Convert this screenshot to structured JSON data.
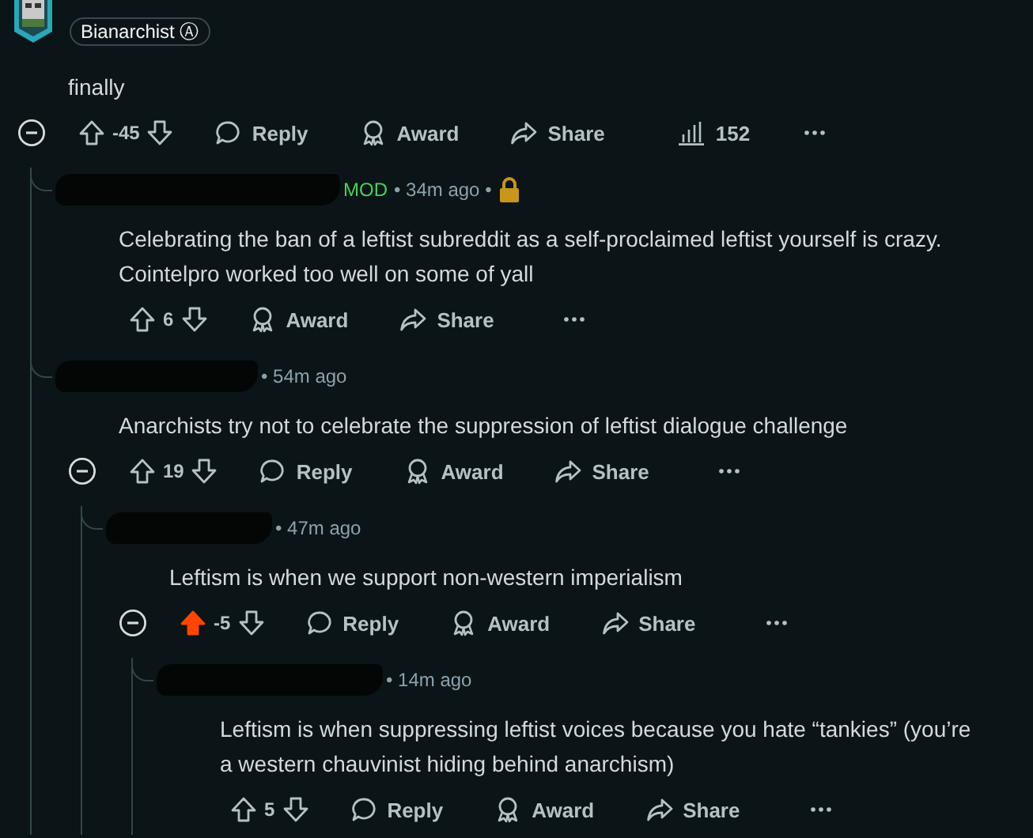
{
  "comments": [
    {
      "flair": "Bianarchist Ⓐ",
      "text": "finally",
      "score": "-45",
      "upvoted": false,
      "expanded": true,
      "views": "152",
      "actions": [
        {
          "kind": "reply",
          "label": "Reply"
        },
        {
          "kind": "award",
          "label": "Award"
        },
        {
          "kind": "share",
          "label": "Share"
        }
      ],
      "children": [
        {
          "role": "MOD",
          "time": "• 34m ago •",
          "locked": true,
          "text": "Celebrating the ban of a leftist subreddit as a self-proclaimed leftist yourself is crazy. Cointelpro worked too well on some of yall",
          "score": "6",
          "upvoted": false,
          "actions": [
            {
              "kind": "award",
              "label": "Award"
            },
            {
              "kind": "share",
              "label": "Share"
            }
          ]
        },
        {
          "time": "• 54m ago",
          "text": "Anarchists try not to celebrate the suppression of leftist dialogue challenge",
          "score": "19",
          "upvoted": false,
          "expanded": true,
          "actions": [
            {
              "kind": "reply",
              "label": "Reply"
            },
            {
              "kind": "award",
              "label": "Award"
            },
            {
              "kind": "share",
              "label": "Share"
            }
          ],
          "children": [
            {
              "time": "• 47m ago",
              "text": "Leftism is when we support non-western imperialism",
              "score": "-5",
              "upvoted": true,
              "expanded": true,
              "actions": [
                {
                  "kind": "reply",
                  "label": "Reply"
                },
                {
                  "kind": "award",
                  "label": "Award"
                },
                {
                  "kind": "share",
                  "label": "Share"
                }
              ],
              "children": [
                {
                  "time": "• 14m ago",
                  "text": "Leftism is when suppressing leftist voices because you hate “tankies” (you’re a western chauvinist hiding behind anarchism)",
                  "score": "5",
                  "upvoted": false,
                  "actions": [
                    {
                      "kind": "reply",
                      "label": "Reply"
                    },
                    {
                      "kind": "award",
                      "label": "Award"
                    },
                    {
                      "kind": "share",
                      "label": "Share"
                    }
                  ]
                }
              ]
            }
          ]
        }
      ]
    }
  ]
}
